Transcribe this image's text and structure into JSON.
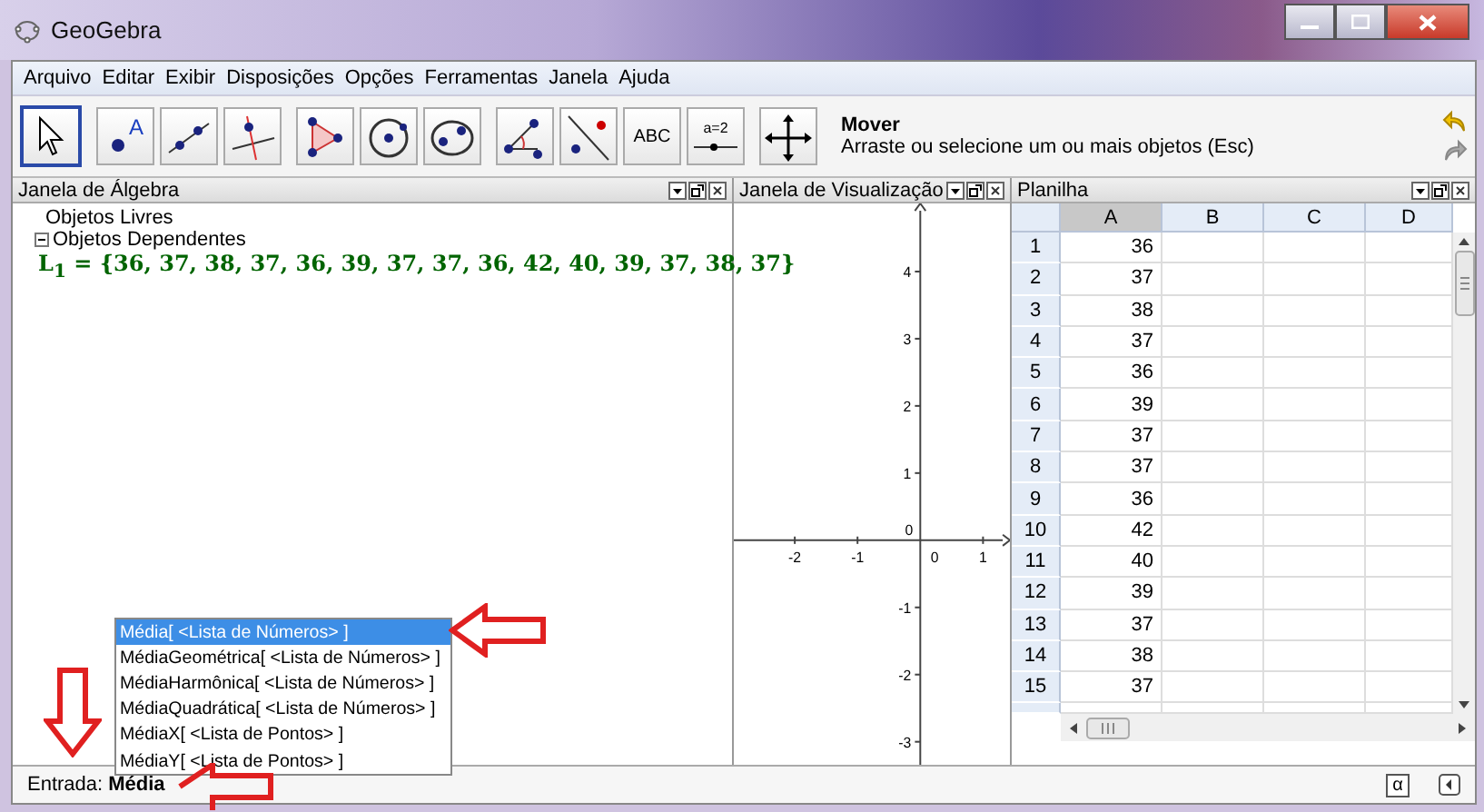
{
  "window": {
    "title": "GeoGebra"
  },
  "menu": [
    "Arquivo",
    "Editar",
    "Exibir",
    "Disposições",
    "Opções",
    "Ferramentas",
    "Janela",
    "Ajuda"
  ],
  "toolbar": {
    "tools": [
      {
        "selected": true
      },
      {
        "selected": false,
        "label": "A"
      },
      {
        "selected": false
      },
      {
        "selected": false
      },
      {
        "selected": false
      },
      {
        "selected": false
      },
      {
        "selected": false
      },
      {
        "selected": false
      },
      {
        "selected": false
      },
      {
        "selected": false,
        "label": "ABC"
      },
      {
        "selected": false,
        "label": "a=2"
      },
      {
        "selected": false
      }
    ],
    "help_title": "Mover",
    "help_text": "Arraste ou selecione um ou mais objetos (Esc)"
  },
  "algebra": {
    "title": "Janela de Álgebra",
    "free_label": "Objetos Livres",
    "dependent": {
      "label": "Objetos Dependentes",
      "expanded": true,
      "children": [
        {
          "formula": "L$_{1}$ = {36, 37, 38, 37, 36, 39, 37, 37, 36, 42, 40, 39, 37, 38, 37}"
        }
      ]
    }
  },
  "graphics": {
    "title": "Janela de Visualização",
    "x_labels": [
      "-2",
      "-1",
      "0",
      "1"
    ],
    "y_labels": [
      "4",
      "3",
      "2",
      "1",
      "0",
      "-1",
      "-2",
      "-3"
    ]
  },
  "spreadsheet": {
    "title": "Planilha",
    "columns": [
      {
        "label": "A",
        "selected": true
      },
      {
        "label": "B",
        "selected": false
      },
      {
        "label": "C",
        "selected": false
      },
      {
        "label": "D",
        "selected": false
      }
    ],
    "rows": [
      {
        "label": "1",
        "a": "36"
      },
      {
        "label": "2",
        "a": "37"
      },
      {
        "label": "3",
        "a": "38"
      },
      {
        "label": "4",
        "a": "37"
      },
      {
        "label": "5",
        "a": "36"
      },
      {
        "label": "6",
        "a": "39"
      },
      {
        "label": "7",
        "a": "37"
      },
      {
        "label": "8",
        "a": "37"
      },
      {
        "label": "9",
        "a": "36"
      },
      {
        "label": "10",
        "a": "42"
      },
      {
        "label": "11",
        "a": "40"
      },
      {
        "label": "12",
        "a": "39"
      },
      {
        "label": "13",
        "a": "37"
      },
      {
        "label": "14",
        "a": "38"
      },
      {
        "label": "15",
        "a": "37"
      }
    ]
  },
  "suggestions": [
    {
      "text": "Média[ <Lista de Números> ]",
      "selected": true
    },
    {
      "text": "MédiaGeométrica[ <Lista de Números> ]",
      "selected": false
    },
    {
      "text": "MédiaHarmônica[ <Lista de Números> ]",
      "selected": false
    },
    {
      "text": "MédiaQuadrática[ <Lista de Números> ]",
      "selected": false
    },
    {
      "text": "MédiaX[ <Lista de Pontos> ]",
      "selected": false
    },
    {
      "text": "MédiaY[ <Lista de Pontos> ]",
      "selected": false
    }
  ],
  "input": {
    "label": "Entrada:",
    "value": "Média",
    "symbol_button": "α"
  }
}
